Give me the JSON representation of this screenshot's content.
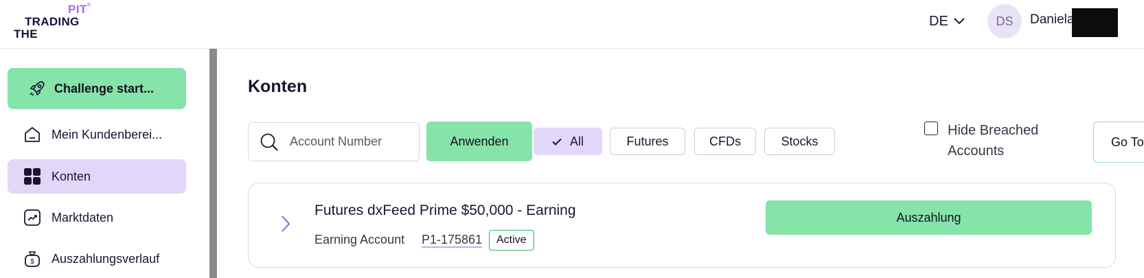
{
  "brand": {
    "logo_line1": "PIT",
    "logo_line2": "TRADING",
    "logo_line3": "THE"
  },
  "header": {
    "language": "DE",
    "avatar_initials": "DS",
    "user_name": "Daniela"
  },
  "sidebar": {
    "challenge_button": "Challenge start...",
    "items": [
      {
        "label": "Mein Kundenberei...",
        "icon": "home-icon",
        "active": false
      },
      {
        "label": "Konten",
        "icon": "grid-icon",
        "active": true
      },
      {
        "label": "Marktdaten",
        "icon": "chart-icon",
        "active": false
      },
      {
        "label": "Auszahlungsverlauf",
        "icon": "money-bag-icon",
        "active": false
      }
    ]
  },
  "main": {
    "title": "Konten",
    "search": {
      "placeholder": "Account Number"
    },
    "apply_button": "Anwenden",
    "filters": [
      {
        "label": "All",
        "active": true
      },
      {
        "label": "Futures",
        "active": false
      },
      {
        "label": "CFDs",
        "active": false
      },
      {
        "label": "Stocks",
        "active": false
      }
    ],
    "hide_breached_label": "Hide Breached Accounts",
    "goto_button": "Go To",
    "account": {
      "title": "Futures dxFeed Prime $50,000 - Earning",
      "type": "Earning Account",
      "number": "P1-175861",
      "status": "Active",
      "payout_button": "Auszahlung"
    }
  },
  "colors": {
    "accent_green": "#86e3aa",
    "accent_purple": "#e2d7f8",
    "brand_purple": "#a468f0",
    "text_dark": "#1c1530"
  }
}
